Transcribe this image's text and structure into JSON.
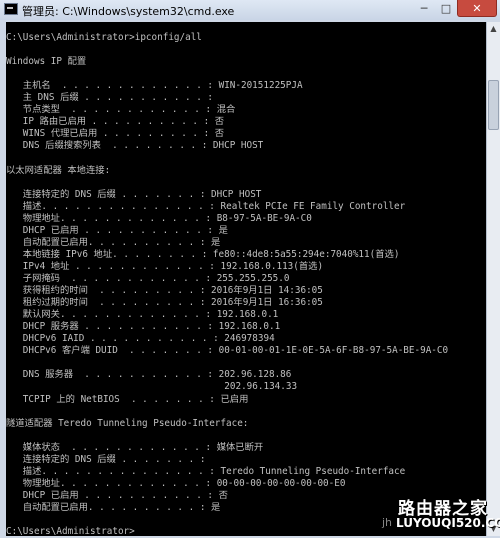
{
  "window": {
    "title": "管理员: C:\\Windows\\system32\\cmd.exe",
    "controls": {
      "minimize": "─",
      "maximize": "□",
      "close": "✕"
    }
  },
  "console": {
    "lines": [
      "C:\\Users\\Administrator>ipconfig/all",
      "",
      "Windows IP 配置",
      "",
      "   主机名  . . . . . . . . . . . . . : WIN-20151225PJA",
      "   主 DNS 后缀 . . . . . . . . . . . :",
      "   节点类型  . . . . . . . . . . . . : 混合",
      "   IP 路由已启用 . . . . . . . . . . : 否",
      "   WINS 代理已启用 . . . . . . . . . : 否",
      "   DNS 后缀搜索列表  . . . . . . . . : DHCP HOST",
      "",
      "以太网适配器 本地连接:",
      "",
      "   连接特定的 DNS 后缀 . . . . . . . : DHCP HOST",
      "   描述. . . . . . . . . . . . . . . : Realtek PCIe FE Family Controller",
      "   物理地址. . . . . . . . . . . . . : B8-97-5A-BE-9A-C0",
      "   DHCP 已启用 . . . . . . . . . . . : 是",
      "   自动配置已启用. . . . . . . . . . : 是",
      "   本地链接 IPv6 地址. . . . . . . . : fe80::4de8:5a55:294e:7040%11(首选)",
      "   IPv4 地址 . . . . . . . . . . . . : 192.168.0.113(首选)",
      "   子网掩码  . . . . . . . . . . . . : 255.255.255.0",
      "   获得租约的时间  . . . . . . . . . : 2016年9月1日 14:36:05",
      "   租约过期的时间  . . . . . . . . . : 2016年9月1日 16:36:05",
      "   默认网关. . . . . . . . . . . . . : 192.168.0.1",
      "   DHCP 服务器 . . . . . . . . . . . : 192.168.0.1",
      "   DHCPv6 IAID . . . . . . . . . . . : 246978394",
      "   DHCPv6 客户端 DUID  . . . . . . . : 00-01-00-01-1E-0E-5A-6F-B8-97-5A-BE-9A-C0",
      "",
      "   DNS 服务器  . . . . . . . . . . . : 202.96.128.86",
      "                                       202.96.134.33",
      "   TCPIP 上的 NetBIOS  . . . . . . . : 已启用",
      "",
      "隧道适配器 Teredo Tunneling Pseudo-Interface:",
      "",
      "   媒体状态  . . . . . . . . . . . . : 媒体已断开",
      "   连接特定的 DNS 后缀 . . . . . . . :",
      "   描述. . . . . . . . . . . . . . . : Teredo Tunneling Pseudo-Interface",
      "   物理地址. . . . . . . . . . . . . : 00-00-00-00-00-00-00-E0",
      "   DHCP 已启用 . . . . . . . . . . . : 否",
      "   自动配置已启用. . . . . . . . . . : 是",
      "",
      "C:\\Users\\Administrator>"
    ]
  },
  "scrollbar": {
    "up_icon": "up-arrow-icon",
    "down_icon": "down-arrow-icon"
  },
  "watermark": {
    "text": "路由器之家",
    "url": "LUYOUQI520.COM",
    "prefix": "jh"
  }
}
